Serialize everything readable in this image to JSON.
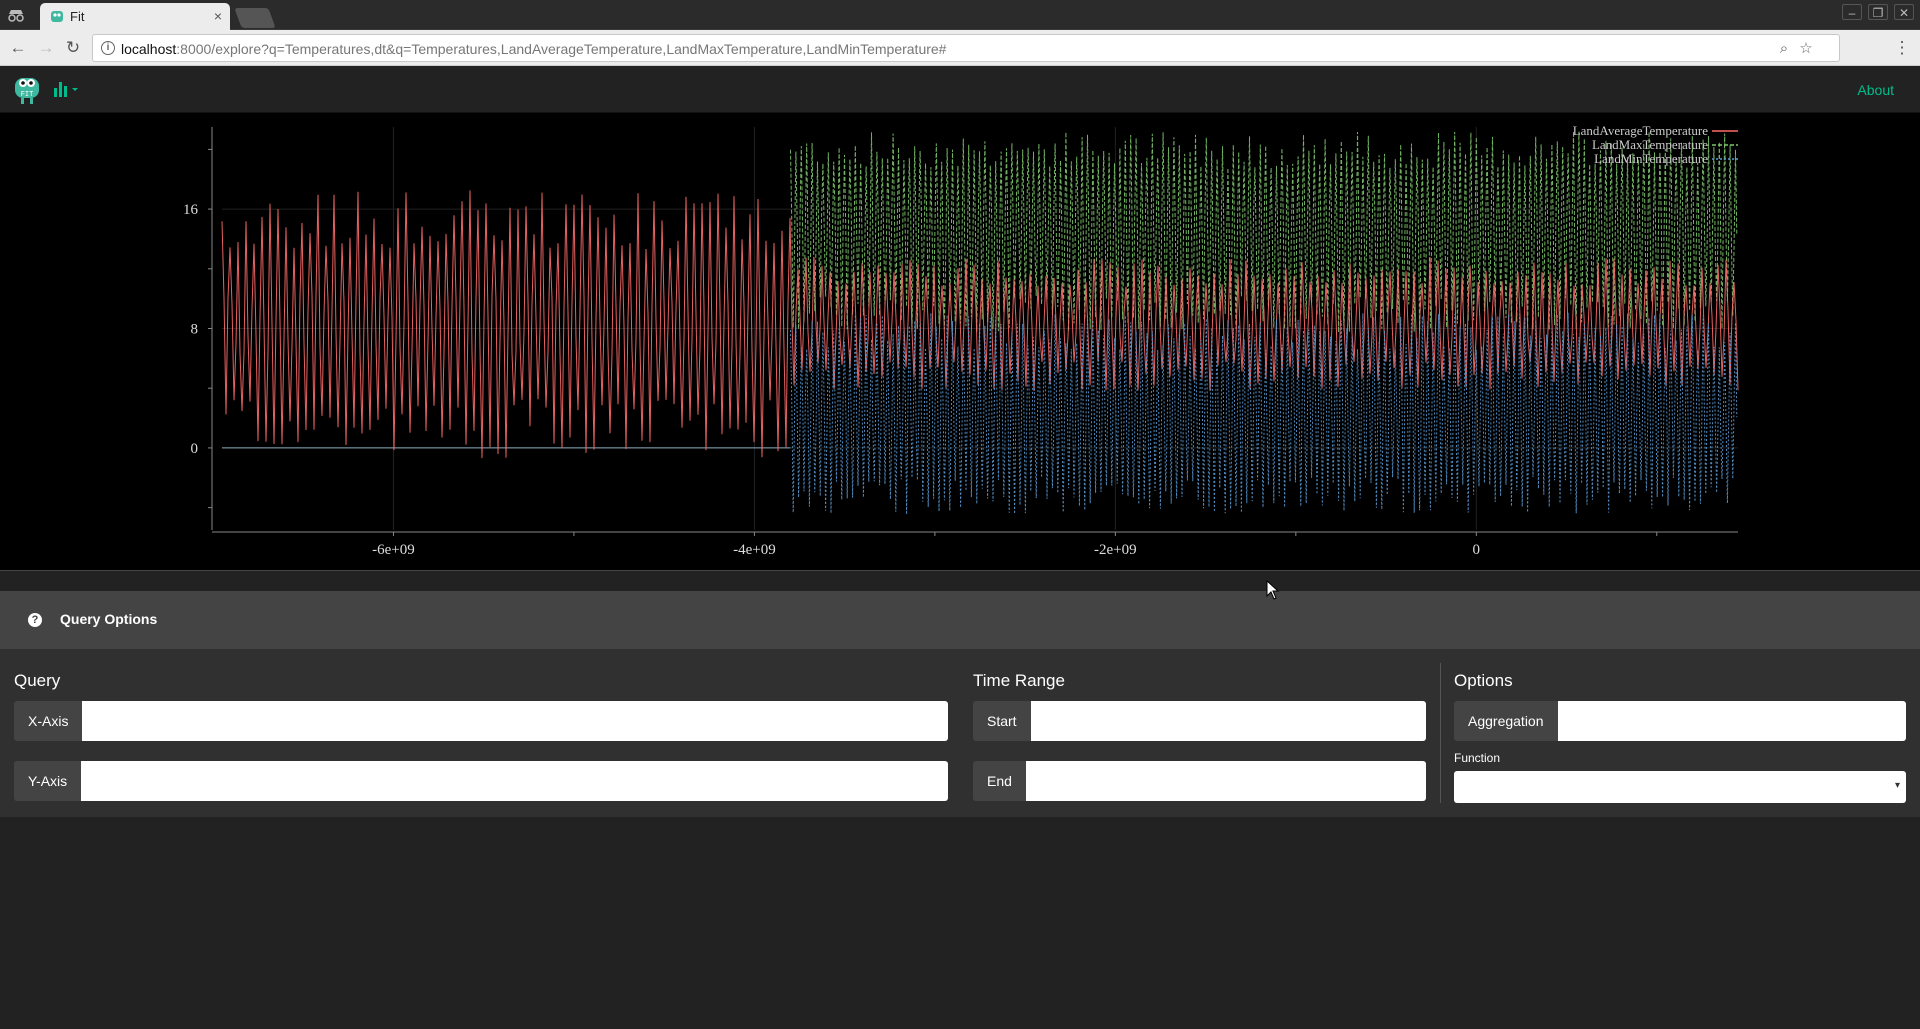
{
  "browser": {
    "tab_title": "Fit",
    "tab_close": "×",
    "url_host": "localhost",
    "url_rest": ":8000/explore?q=Temperatures,dt&q=Temperatures,LandAverageTemperature,LandMaxTemperature,LandMinTemperature#"
  },
  "navbar": {
    "logo_text": "FIT",
    "about_label": "About"
  },
  "chart_data": {
    "type": "line",
    "x_ticks": [
      "-6e+09",
      "-4e+09",
      "-2e+09",
      "0"
    ],
    "x_tick_values": [
      -6000000000,
      -4000000000,
      -2000000000,
      0
    ],
    "y_ticks": [
      "0",
      "8",
      "16"
    ],
    "y_tick_values": [
      0,
      8,
      16
    ],
    "xlim": [
      -6950000000,
      1450000000
    ],
    "ylim": [
      -5.5,
      21.5
    ],
    "legend_placement": "top-right",
    "series": [
      {
        "name": "LandAverageTemperature",
        "color": "#ff6b6b",
        "style": "solid",
        "x_start": -6950000000,
        "x_end": 1450000000,
        "center": 8.3,
        "amplitude": 7.0
      },
      {
        "name": "LandMaxTemperature",
        "color": "#7ec66e",
        "style": "dashed",
        "x_start": -3800000000,
        "x_end": 1450000000,
        "center": 14.5,
        "amplitude": 5.5
      },
      {
        "name": "LandMinTemperature",
        "color": "#5b9bd5",
        "style": "dotted",
        "x_start": -3800000000,
        "x_end": 1450000000,
        "center": 2.3,
        "amplitude": 5.5
      }
    ],
    "baseline_y": 0,
    "grid": true
  },
  "query_options": {
    "header": "Query Options",
    "query_title": "Query",
    "x_axis_label": "X-Axis",
    "y_axis_label": "Y-Axis",
    "x_axis_value": "",
    "y_axis_value": "",
    "time_range_title": "Time Range",
    "start_label": "Start",
    "end_label": "End",
    "start_value": "",
    "end_value": "",
    "options_title": "Options",
    "aggregation_label": "Aggregation",
    "aggregation_value": "",
    "function_label": "Function",
    "function_value": ""
  }
}
